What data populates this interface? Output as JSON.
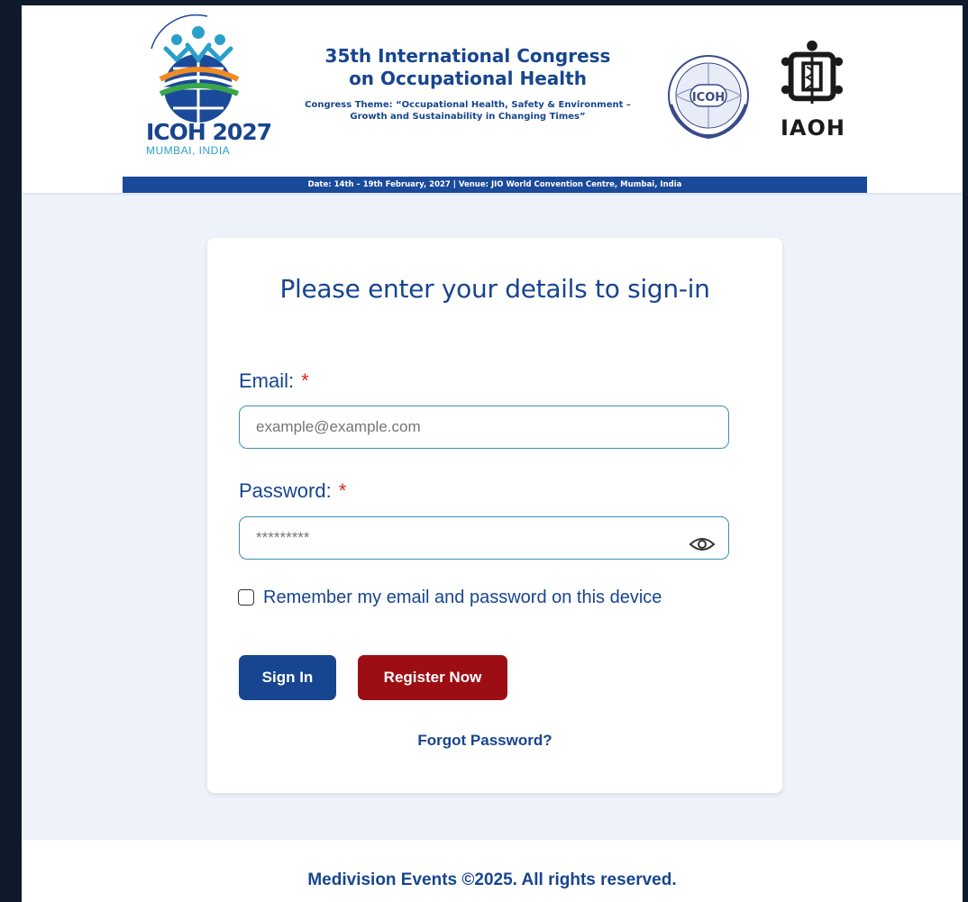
{
  "banner": {
    "logo_text": "ICOH 2027",
    "logo_sub": "MUMBAI, INDIA",
    "title_line1": "35th International Congress",
    "title_line2": "on Occupational Health",
    "theme_line1": "Congress Theme: “Occupational Health, Safety & Environment –",
    "theme_line2": "Growth and Sustainability in Changing Times”",
    "seal_text": "ICOH",
    "iaoh_text": "IAOH",
    "date_strip": "Date: 14th – 19th February, 2027 | Venue: JIO World Convention Centre, Mumbai, India"
  },
  "form": {
    "title": "Please enter your details to sign-in",
    "email_label": "Email:",
    "email_placeholder": "example@example.com",
    "password_label": "Password:",
    "password_placeholder": "*********",
    "required_mark": "*",
    "remember_label": "Remember my email and password on this device",
    "signin_label": "Sign In",
    "register_label": "Register Now",
    "forgot_label": "Forgot Password?"
  },
  "footer": {
    "text": "Medivision Events ©2025. All rights reserved."
  },
  "colors": {
    "primary": "#17458f",
    "danger": "#9c0e14",
    "required": "#e02424",
    "page_bg": "#eef3fb"
  }
}
